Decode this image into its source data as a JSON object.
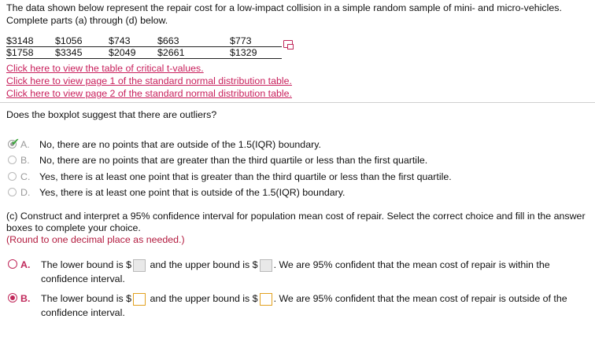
{
  "intro": "The data shown below represent the repair cost for a low-impact collision in a simple random sample of mini- and micro-vehicles. Complete parts (a) through (d) below.",
  "table": {
    "row1": [
      "$3148",
      "$1056",
      "$743",
      "$663",
      "$773"
    ],
    "row2": [
      "$1758",
      "$3345",
      "$2049",
      "$2661",
      "$1329"
    ]
  },
  "links": [
    "Click here to view the table of critical t-values.",
    "Click here to view page 1 of the standard normal distribution table.",
    "Click here to view page 2 of the standard normal distribution table."
  ],
  "question_b": "Does the boxplot suggest that there are outliers?",
  "options_b": [
    {
      "letter": "A.",
      "text": "No, there are no points that are outside of the 1.5(IQR) boundary."
    },
    {
      "letter": "B.",
      "text": "No, there are no points that are greater than the third quartile or less than the first quartile."
    },
    {
      "letter": "C.",
      "text": "Yes, there is at least one point that is greater than the third quartile or less than the first quartile."
    },
    {
      "letter": "D.",
      "text": "Yes, there is at least one point that is outside of the 1.5(IQR) boundary."
    }
  ],
  "part_c": {
    "prompt": "(c) Construct and interpret a 95% confidence interval for population mean cost of repair. Select the correct choice and fill in the answer boxes to complete your choice.",
    "round_note": "(Round to one decimal place as needed.)",
    "options": [
      {
        "letter": "A.",
        "pre": "The lower bound is $",
        "mid": " and the upper bound is $",
        "post": ". We are 95% confident that the mean cost of repair is within the confidence interval."
      },
      {
        "letter": "B.",
        "pre": "The lower bound is $",
        "mid": " and the upper bound is $",
        "post": ". We are 95% confident that the mean cost of repair is outside of the confidence interval."
      }
    ]
  },
  "colors": {
    "link": "#c8205c",
    "accent": "#c0285a",
    "check": "#3aa43a",
    "input_border_active": "#e2a11f"
  }
}
